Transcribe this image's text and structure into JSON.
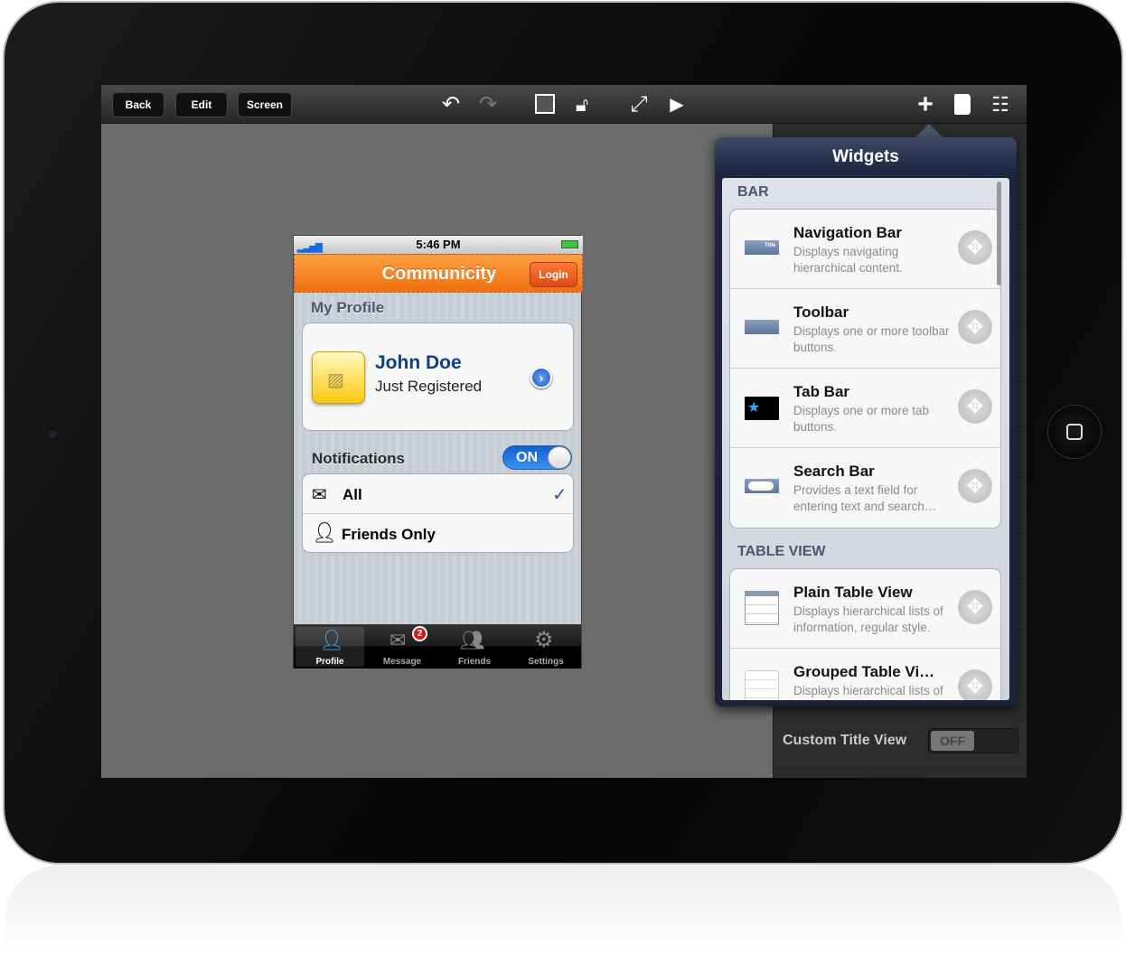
{
  "toolbar": {
    "back": "Back",
    "edit": "Edit",
    "screen": "Screen",
    "icons": [
      "undo-icon",
      "redo-icon",
      "frame-icon",
      "unlock-icon",
      "fullscreen-icon",
      "play-icon",
      "add-icon",
      "book-icon",
      "sliders-icon"
    ]
  },
  "phone": {
    "status_time": "5:46 PM",
    "nav_title": "Communicity",
    "login": "Login",
    "my_profile": "My Profile",
    "name": "John Doe",
    "subtitle": "Just Registered",
    "notifications": "Notifications",
    "toggle": "ON",
    "options": [
      {
        "label": "All",
        "checked": true
      },
      {
        "label": "Friends Only",
        "checked": false
      }
    ],
    "tabs": [
      {
        "label": "Profile",
        "active": true
      },
      {
        "label": "Message",
        "badge": "2"
      },
      {
        "label": "Friends"
      },
      {
        "label": "Settings"
      }
    ]
  },
  "widgets": {
    "title": "Widgets",
    "sections": [
      {
        "header": "BAR",
        "items": [
          {
            "name": "Navigation Bar",
            "desc": "Displays navigating hierarchical content.",
            "icon_text": "Title"
          },
          {
            "name": "Toolbar",
            "desc": "Displays one or more toolbar buttons."
          },
          {
            "name": "Tab Bar",
            "desc": "Displays one or more tab buttons."
          },
          {
            "name": "Search Bar",
            "desc": "Provides a text field for entering text and search…"
          }
        ]
      },
      {
        "header": "TABLE VIEW",
        "items": [
          {
            "name": "Plain Table View",
            "desc": "Displays hierarchical lists of information, regular style."
          },
          {
            "name": "Grouped Table Vi…",
            "desc": "Displays hierarchical lists of"
          }
        ]
      }
    ]
  },
  "inspector": {
    "custom_title_view": "Custom Title View",
    "toggle": "OFF"
  },
  "colors": {
    "accent_orange": "#f58020",
    "toggle_blue": "#1a7ae0",
    "popover_navy": "#1b2540"
  }
}
